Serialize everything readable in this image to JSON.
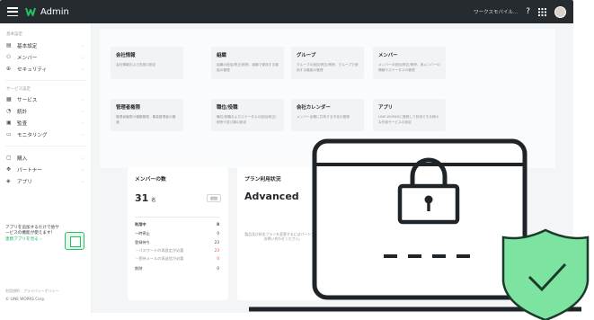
{
  "topbar": {
    "title": "Admin",
    "workspace": "ワークスモバイル...",
    "help_icon": "help-icon",
    "apps_icon": "apps-grid-icon"
  },
  "sidebar": {
    "basic_section": "基本設定",
    "basic_items": [
      {
        "label": "基本設定",
        "icon": "building-icon"
      },
      {
        "label": "メンバー",
        "icon": "users-icon"
      },
      {
        "label": "セキュリティ",
        "icon": "lock-icon"
      }
    ],
    "service_section": "サービス設定",
    "service_items": [
      {
        "label": "サービス",
        "icon": "grid-icon"
      },
      {
        "label": "統計",
        "icon": "chart-icon"
      },
      {
        "label": "監査",
        "icon": "audit-icon"
      },
      {
        "label": "モニタリング",
        "icon": "monitor-icon"
      }
    ],
    "other_items": [
      {
        "label": "購入",
        "icon": "cart-icon"
      },
      {
        "label": "パートナー",
        "icon": "handshake-icon"
      },
      {
        "label": "アプリ",
        "icon": "apps-icon"
      }
    ],
    "promo": {
      "text": "アプリを追加するだけで他サービスの機能が使えます！",
      "link": "連携アプリを見る ›"
    },
    "footer_links": "利用規約 · プライバシーポリシー",
    "copyright": "© LINE WORKS Corp."
  },
  "tiles": [
    {
      "title": "会社情報",
      "desc": "会社情報および言語の設定"
    },
    {
      "title": "組織",
      "desc": "組織の追加/修正/削除、組織で使用する機能の管理"
    },
    {
      "title": "グループ",
      "desc": "グループの追加/修正/削除、グループで使用する機能の管理"
    },
    {
      "title": "メンバー",
      "desc": "メンバーの追加/修正/削除、各メンバーの情報やステータスの管理"
    },
    {
      "title": "管理者権限",
      "desc": "管理者権限の種類管理、最高管理者の譲渡"
    },
    {
      "title": "職位/役職",
      "desc": "職位/役職およびステータスの追加/修正/削除や並び順の設定"
    },
    {
      "title": "会社カレンダー",
      "desc": "メンバー全員に共有する予定の登録"
    },
    {
      "title": "アプリ",
      "desc": "LINE WORKSに登録して利用できる様々な外部サービスの設定"
    }
  ],
  "member_card": {
    "title": "メンバーの数",
    "count": "31",
    "unit": "名",
    "add_label": "追加",
    "rows": [
      {
        "label": "利用中",
        "value": "8",
        "bold": true
      },
      {
        "label": "一時停止",
        "value": "0"
      },
      {
        "label": "登録待ち",
        "value": "23"
      },
      {
        "label": "・パスワードの再設定が必要",
        "value": "23",
        "red": true
      },
      {
        "label": "・招待メールの再送信が必要",
        "value": "0"
      },
      {
        "label": "削除",
        "value": "0"
      }
    ]
  },
  "plan_card": {
    "title": "プラン利用状況",
    "plan": "Advanced",
    "desc": "製品及び料金プランを変更するにはパートナーにお問い合わせください。"
  },
  "colors": {
    "topbar_bg": "#262b30",
    "brand_green": "#21c45d",
    "shield_green": "#7de3a0",
    "shield_check": "#1b3b2a"
  }
}
